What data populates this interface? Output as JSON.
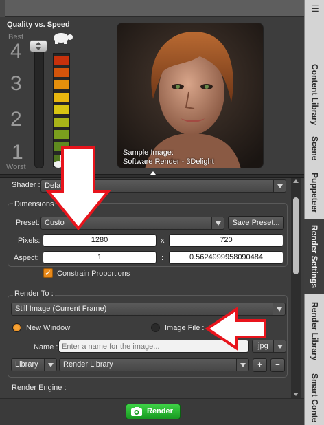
{
  "preview": {
    "quality_title": "Quality vs. Speed",
    "best_label": "Best",
    "worst_label": "Worst",
    "levels": [
      "4",
      "3",
      "2",
      "1"
    ],
    "quality_level": 1.0,
    "meter_colors": [
      "#c7310c",
      "#d3540b",
      "#e58f0c",
      "#e9b70f",
      "#d8c512",
      "#a8b418",
      "#7a9f1d",
      "#5f8a1f",
      "#4f7320"
    ],
    "sample_caption_line1": "Sample Image:",
    "sample_caption_line2": "Software Render - 3Delight"
  },
  "tabs": [
    {
      "label": "Content Library",
      "active": false
    },
    {
      "label": "Scene",
      "active": false
    },
    {
      "label": "Puppeteer",
      "active": false
    },
    {
      "label": "Render Settings",
      "active": true
    },
    {
      "label": "Render Library",
      "active": false
    },
    {
      "label": "Smart Conte",
      "active": false
    }
  ],
  "settings": {
    "shader_label": "Shader :",
    "shader_value": "Defa",
    "dimensions_title": "Dimensions",
    "preset_label": "Preset:",
    "preset_value": "Custo",
    "save_preset_label": "Save Preset...",
    "pixels_label": "Pixels:",
    "pixels_width": "1280",
    "pixels_separator": "x",
    "pixels_height": "720",
    "aspect_label": "Aspect:",
    "aspect_width": "1",
    "aspect_separator": ":",
    "aspect_height": "0.5624999958090484",
    "constrain_label": "Constrain Proportions",
    "constrain_checked": true,
    "render_to_title": "Render To :",
    "render_to_value": "Still Image (Current Frame)",
    "new_window_label": "New Window",
    "image_file_label": "Image File :",
    "name_label": "Name :",
    "name_placeholder": "Enter a name for the image...",
    "format_value": ".jpg",
    "library_value": "Library",
    "render_library_value": "Render Library",
    "add_label": "+",
    "remove_label": "−",
    "render_engine_title": "Render Engine :"
  },
  "footer": {
    "render_label": "Render"
  },
  "colors": {
    "accent_orange": "#e98a1a",
    "render_green": "#2ebd36",
    "annotation_red": "#e8141c"
  }
}
